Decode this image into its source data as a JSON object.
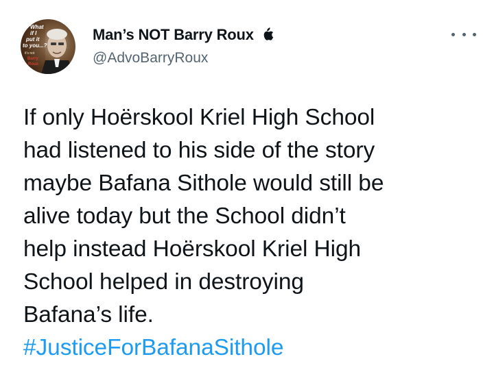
{
  "author": {
    "display_name": "Man’s NOT Barry Roux",
    "handle": "@AdvoBarryRoux",
    "avatar_caption": [
      "What",
      "if I",
      "put it",
      "to you...?",
      "it's not",
      "Barry",
      "Roux"
    ]
  },
  "tweet": {
    "text_lines": [
      "If only Hoërskool Kriel High School",
      "had listened to his side of the story",
      "maybe Bafana Sithole would still be",
      "alive today but the School didn’t",
      "help instead Hoërskool Kriel High",
      "School helped in destroying",
      "Bafana’s life."
    ],
    "hashtag": "#JusticeForBafanaSithole"
  },
  "colors": {
    "text": "#0f1419",
    "secondary": "#536471",
    "link": "#1d9bf0",
    "background": "#ffffff"
  },
  "icons": {
    "verified_mark": "apple-icon",
    "menu": "more-options-icon"
  }
}
